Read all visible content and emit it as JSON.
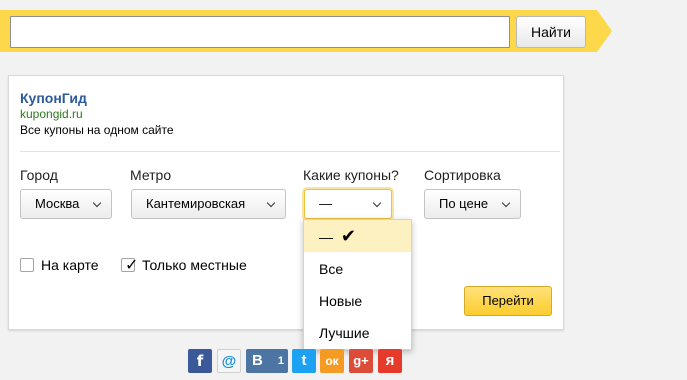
{
  "search": {
    "button_label": "Найти",
    "value": ""
  },
  "ad": {
    "title": "КупонГид",
    "url": "kupongid.ru",
    "text": "Все купоны на одном сайте"
  },
  "filters": {
    "city": {
      "label": "Город",
      "value": "Москва"
    },
    "metro": {
      "label": "Метро",
      "value": "Кантемировская"
    },
    "coupons": {
      "label": "Какие купоны?",
      "value": "—"
    },
    "sort": {
      "label": "Сортировка",
      "value": "По цене"
    }
  },
  "checkboxes": {
    "map": {
      "label": "На карте",
      "checked": false
    },
    "local": {
      "label": "Только местные",
      "checked": true
    }
  },
  "go_button": "Перейти",
  "dropdown": {
    "options": [
      {
        "label": "—",
        "selected": true
      },
      {
        "label": "Все"
      },
      {
        "label": "Новые"
      },
      {
        "label": "Лучшие"
      }
    ]
  },
  "social": {
    "facebook": "f",
    "mailru": "@",
    "vkontakte": "В",
    "vk_count": "1",
    "twitter": "t",
    "odnoklassniki": "ок",
    "googleplus": "g+",
    "yaru": "я"
  },
  "colors": {
    "band": "#fdd84a",
    "link": "#2d5b99",
    "url": "#2c7a1f",
    "accent_button": "#fccd2e"
  }
}
